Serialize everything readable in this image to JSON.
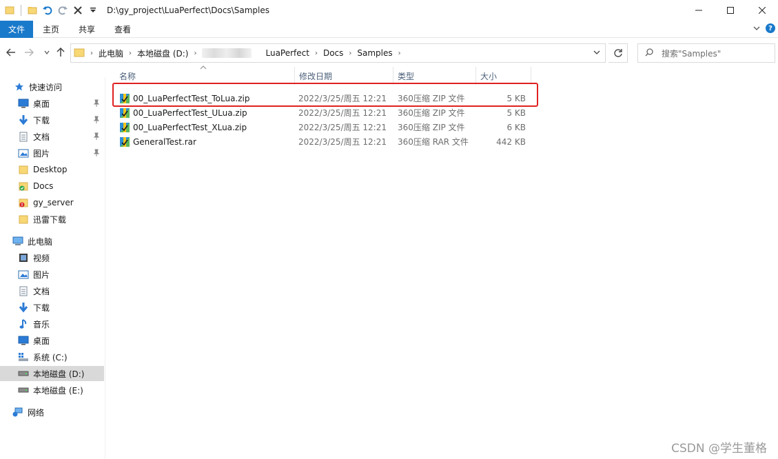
{
  "window": {
    "title": "D:\\gy_project\\LuaPerfect\\Docs\\Samples"
  },
  "ribbon": {
    "tabs": [
      "文件",
      "主页",
      "共享",
      "查看"
    ],
    "help_glyph": "?"
  },
  "address": {
    "crumbs": [
      "此电脑",
      "本地磁盘 (D:)",
      "LuaPerfect",
      "Docs",
      "Samples"
    ]
  },
  "search": {
    "placeholder": "搜索\"Samples\""
  },
  "nav": {
    "quick_access": "快速访问",
    "quick_items": [
      "桌面",
      "下载",
      "文档",
      "图片",
      "Desktop",
      "Docs",
      "gy_server",
      "迅雷下载"
    ],
    "this_pc": "此电脑",
    "pc_items": [
      "视频",
      "图片",
      "文档",
      "下载",
      "音乐",
      "桌面",
      "系统 (C:)",
      "本地磁盘 (D:)",
      "本地磁盘 (E:)"
    ],
    "network": "网络"
  },
  "columns": {
    "name": "名称",
    "date": "修改日期",
    "type": "类型",
    "size": "大小"
  },
  "files": [
    {
      "name": "00_LuaPerfectTest_ToLua.zip",
      "date": "2022/3/25/周五 12:21",
      "type": "360压缩 ZIP 文件",
      "size": "5 KB"
    },
    {
      "name": "00_LuaPerfectTest_ULua.zip",
      "date": "2022/3/25/周五 12:21",
      "type": "360压缩 ZIP 文件",
      "size": "5 KB"
    },
    {
      "name": "00_LuaPerfectTest_XLua.zip",
      "date": "2022/3/25/周五 12:21",
      "type": "360压缩 ZIP 文件",
      "size": "6 KB"
    },
    {
      "name": "GeneralTest.rar",
      "date": "2022/3/25/周五 12:21",
      "type": "360压缩 RAR 文件",
      "size": "442 KB"
    }
  ],
  "watermark": "CSDN @学生董格",
  "colors": {
    "accent": "#1979ca",
    "highlight": "#e02020",
    "selection": "#d9d9d9"
  }
}
